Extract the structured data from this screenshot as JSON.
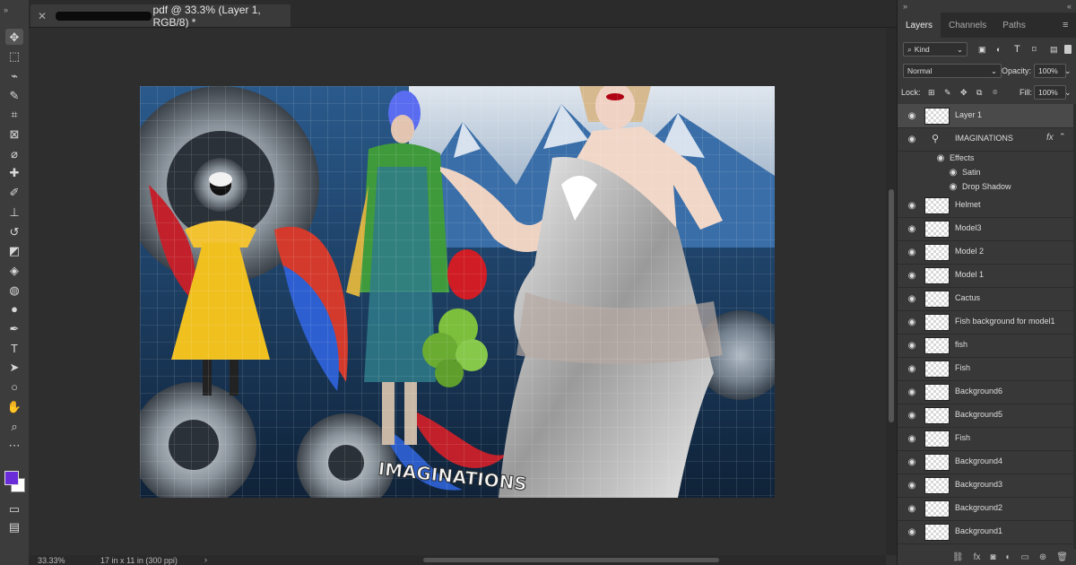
{
  "document": {
    "tab_title": "pdf @ 33.3% (Layer 1, RGB/8) *",
    "zoom": "33.33%",
    "doc_size": "17 in x 11 in (300 ppi)",
    "canvas_text": "IMAGINATIONS"
  },
  "tools": [
    {
      "name": "move-tool-icon",
      "glyph": "✥"
    },
    {
      "name": "marquee-tool-icon",
      "glyph": "⬚"
    },
    {
      "name": "lasso-tool-icon",
      "glyph": "⌁"
    },
    {
      "name": "quick-select-tool-icon",
      "glyph": "✎"
    },
    {
      "name": "crop-tool-icon",
      "glyph": "⌗"
    },
    {
      "name": "frame-tool-icon",
      "glyph": "⊠"
    },
    {
      "name": "eyedropper-tool-icon",
      "glyph": "⌀"
    },
    {
      "name": "healing-brush-tool-icon",
      "glyph": "✚"
    },
    {
      "name": "brush-tool-icon",
      "glyph": "✐"
    },
    {
      "name": "clone-stamp-tool-icon",
      "glyph": "⊥"
    },
    {
      "name": "history-brush-tool-icon",
      "glyph": "↺"
    },
    {
      "name": "eraser-tool-icon",
      "glyph": "◩"
    },
    {
      "name": "paint-bucket-tool-icon",
      "glyph": "◈"
    },
    {
      "name": "blur-tool-icon",
      "glyph": "◍"
    },
    {
      "name": "dodge-tool-icon",
      "glyph": "●"
    },
    {
      "name": "pen-tool-icon",
      "glyph": "✒"
    },
    {
      "name": "type-tool-icon",
      "glyph": "T"
    },
    {
      "name": "path-select-tool-icon",
      "glyph": "➤"
    },
    {
      "name": "shape-tool-icon",
      "glyph": "○"
    },
    {
      "name": "hand-tool-icon",
      "glyph": "✋"
    },
    {
      "name": "zoom-tool-icon",
      "glyph": "⌕"
    },
    {
      "name": "more-tools-icon",
      "glyph": "⋯"
    }
  ],
  "panel": {
    "tabs": [
      "Layers",
      "Channels",
      "Paths"
    ],
    "kind_label": "Kind",
    "blend_mode": "Normal",
    "opacity_label": "Opacity:",
    "opacity_value": "100%",
    "lock_label": "Lock:",
    "fill_label": "Fill:",
    "fill_value": "100%"
  },
  "layers": [
    {
      "name": "Layer 1",
      "selected": true,
      "type": "layer"
    },
    {
      "name": "IMAGINATIONS",
      "type": "text",
      "fx": "fx"
    },
    {
      "name": "Effects",
      "type": "effects"
    },
    {
      "name": "Satin",
      "type": "effect"
    },
    {
      "name": "Drop Shadow",
      "type": "effect"
    },
    {
      "name": "Helmet",
      "type": "layer"
    },
    {
      "name": "Model3",
      "type": "layer"
    },
    {
      "name": "Model 2",
      "type": "layer"
    },
    {
      "name": "Model 1",
      "type": "layer"
    },
    {
      "name": "Cactus",
      "type": "layer"
    },
    {
      "name": "Fish background for model1",
      "type": "layer"
    },
    {
      "name": "fish",
      "type": "layer"
    },
    {
      "name": "Fish",
      "type": "layer"
    },
    {
      "name": "Background6",
      "type": "layer"
    },
    {
      "name": "Background5",
      "type": "layer"
    },
    {
      "name": "Fish",
      "type": "layer"
    },
    {
      "name": "Background4",
      "type": "layer"
    },
    {
      "name": "Background3",
      "type": "layer"
    },
    {
      "name": "Background2",
      "type": "layer"
    },
    {
      "name": "Background1",
      "type": "layer"
    }
  ],
  "colors": {
    "foreground": "#6a2bd8",
    "background": "#ffffff",
    "accent": "#4a4a4a"
  }
}
